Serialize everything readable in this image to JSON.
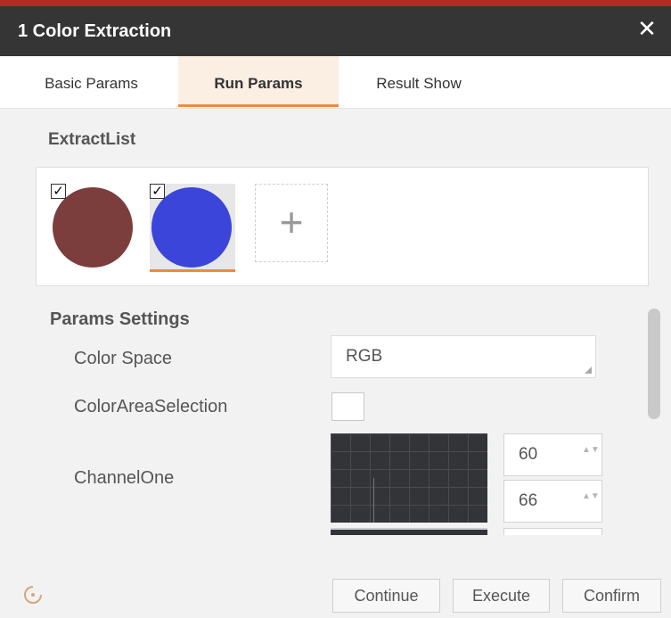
{
  "window": {
    "title": "1 Color Extraction",
    "close_glyph": "✕"
  },
  "tabs": [
    {
      "label": "Basic Params",
      "active": false
    },
    {
      "label": "Run Params",
      "active": true
    },
    {
      "label": "Result Show",
      "active": false
    }
  ],
  "extract_list": {
    "title": "ExtractList",
    "items": [
      {
        "color": "#7b3e3c",
        "checked": true,
        "selected": false
      },
      {
        "color": "#3b45d9",
        "checked": true,
        "selected": true
      }
    ],
    "add_glyph": "+",
    "check_glyph": "✓"
  },
  "params": {
    "title": "Params Settings",
    "color_space": {
      "label": "Color Space",
      "value": "RGB"
    },
    "color_area_selection": {
      "label": "ColorAreaSelection",
      "checked": false
    },
    "channel_one": {
      "label": "ChannelOne",
      "min": "60",
      "max": "66"
    },
    "spin_arrows": "▲▼"
  },
  "footer": {
    "continue_label": "Continue",
    "execute_label": "Execute",
    "confirm_label": "Confirm"
  },
  "colors": {
    "accent": "#ef8a3c",
    "titlebar": "#353535",
    "title_border": "#b52a22"
  }
}
